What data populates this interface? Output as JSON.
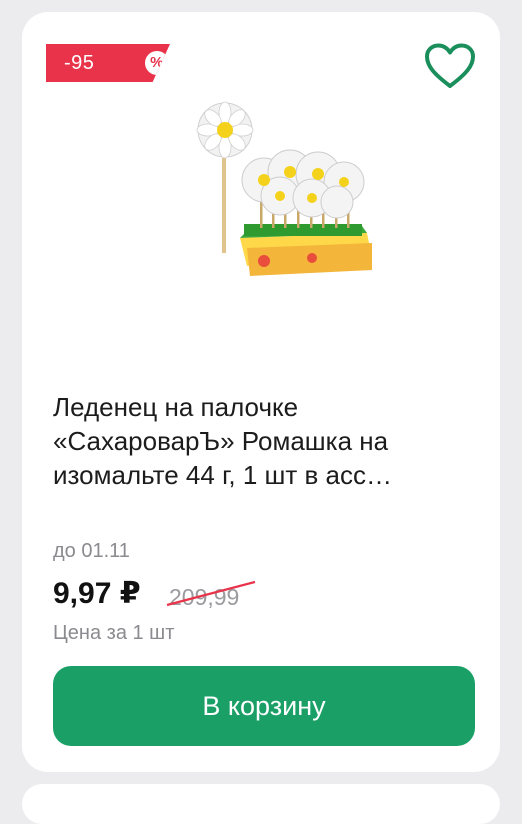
{
  "product": {
    "discount_badge": "-95",
    "discount_symbol": "%",
    "title": "Леденец на палочке «СахароварЪ» Ромашка на изомальте 44 г, 1 шт в асс…",
    "valid_until": "до 01.11",
    "price": "9,97 ₽",
    "old_price": "209,99",
    "unit_price_label": "Цена за 1 шт",
    "cart_button_label": "В корзину",
    "image_icon": "lollipop-daisy-display"
  },
  "colors": {
    "badge": "#e8334a",
    "accent_green": "#1aa067",
    "heart_outline": "#1a8f5c",
    "strike": "#e8334a"
  }
}
